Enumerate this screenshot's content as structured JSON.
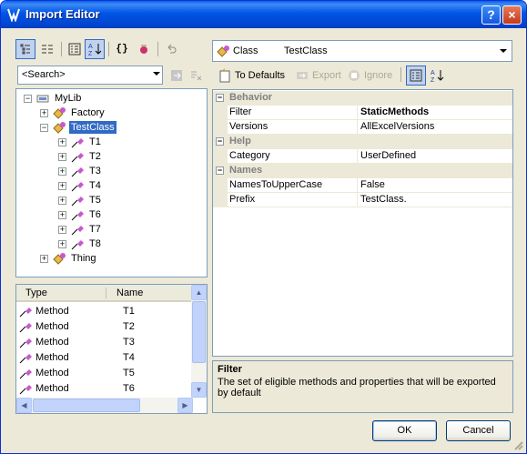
{
  "window": {
    "title": "Import Editor",
    "help_label": "?",
    "close_label": "×"
  },
  "search": {
    "value": "<Search>"
  },
  "tree": {
    "root": "MyLib",
    "children": [
      "Factory",
      "TestClass"
    ],
    "methods": [
      "T1",
      "T2",
      "T3",
      "T4",
      "T5",
      "T6",
      "T7",
      "T8"
    ],
    "last": "Thing"
  },
  "list": {
    "headers": {
      "type": "Type",
      "name": "Name"
    },
    "rows": [
      {
        "type": "Method",
        "name": "T1"
      },
      {
        "type": "Method",
        "name": "T2"
      },
      {
        "type": "Method",
        "name": "T3"
      },
      {
        "type": "Method",
        "name": "T4"
      },
      {
        "type": "Method",
        "name": "T5"
      },
      {
        "type": "Method",
        "name": "T6"
      }
    ]
  },
  "class_combo": {
    "kind": "Class",
    "name": "TestClass"
  },
  "prop_toolbar": {
    "to_defaults": "To Defaults",
    "export": "Export",
    "ignore": "Ignore"
  },
  "grid": {
    "categories": {
      "behavior": "Behavior",
      "help": "Help",
      "names": "Names"
    },
    "props": {
      "filter": {
        "name": "Filter",
        "value": "StaticMethods"
      },
      "versions": {
        "name": "Versions",
        "value": "AllExcelVersions"
      },
      "category": {
        "name": "Category",
        "value": "UserDefined"
      },
      "names_upper": {
        "name": "NamesToUpperCase",
        "value": "False"
      },
      "prefix": {
        "name": "Prefix",
        "value": "TestClass."
      }
    }
  },
  "description": {
    "title": "Filter",
    "text": "The set of eligible methods and properties that will be exported by default"
  },
  "buttons": {
    "ok": "OK",
    "cancel": "Cancel"
  },
  "colors": {
    "title_bar": "#0055E5",
    "selection": "#316AC5",
    "window_bg": "#ECE9D8"
  }
}
